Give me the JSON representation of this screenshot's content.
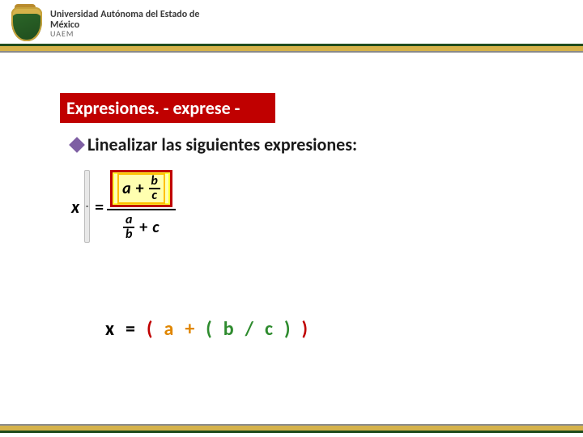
{
  "header": {
    "university_line1": "Universidad Autónoma del Estado de México",
    "university_line2": "UAEM"
  },
  "title": "Expresiones. -  exprese -",
  "bullet": {
    "glyph": "❖",
    "text": "Linealizar las siguientes expresiones:"
  },
  "formula": {
    "lhs_var": "x",
    "eq": "=",
    "eq_button": "=",
    "numerator": {
      "a": "a",
      "plus": "+",
      "frac_top": "b",
      "frac_bot": "c"
    },
    "denominator": {
      "frac_top": "a",
      "frac_bot": "b",
      "plus": "+",
      "c": "c"
    }
  },
  "linearized": {
    "tokens": [
      {
        "t": "x",
        "c": "black"
      },
      {
        "t": "=",
        "c": "black"
      },
      {
        "t": "(",
        "c": "red"
      },
      {
        "t": "a",
        "c": "orange"
      },
      {
        "t": "+",
        "c": "orange"
      },
      {
        "t": "(",
        "c": "green"
      },
      {
        "t": "b",
        "c": "green"
      },
      {
        "t": "/",
        "c": "green"
      },
      {
        "t": "c",
        "c": "green"
      },
      {
        "t": ")",
        "c": "green"
      },
      {
        "t": ")",
        "c": "red"
      }
    ]
  }
}
